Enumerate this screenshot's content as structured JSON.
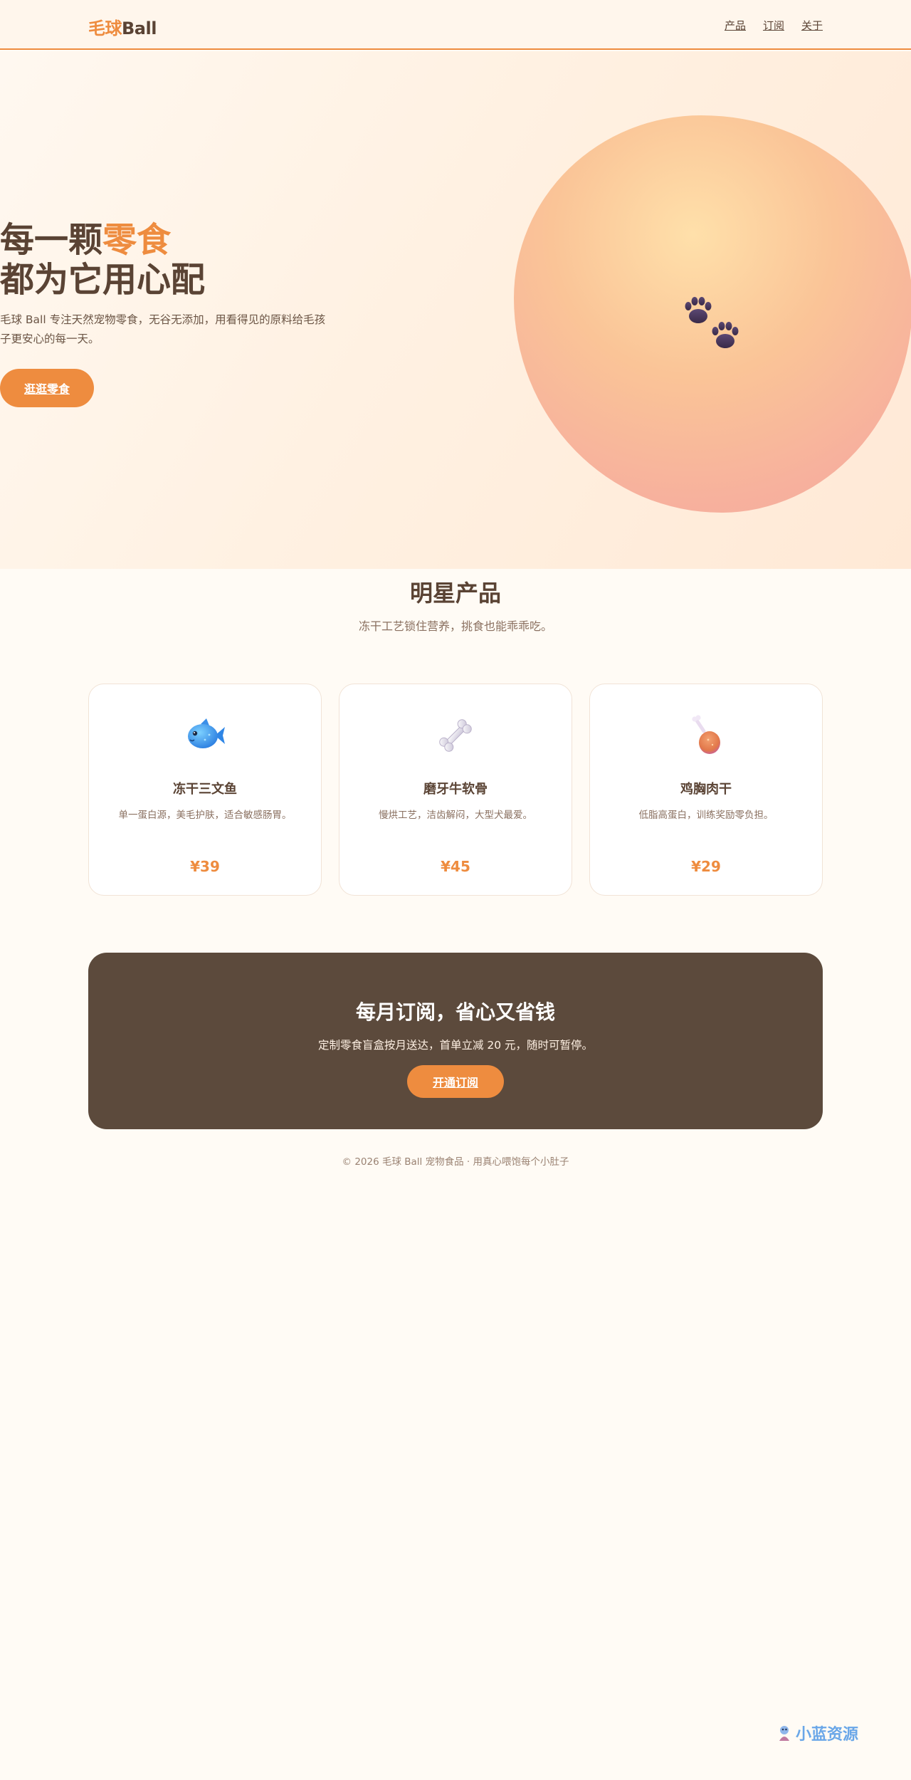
{
  "header": {
    "logo_accent": "毛球",
    "logo_rest": "Ball",
    "nav": [
      "产品",
      "订阅",
      "关于"
    ]
  },
  "hero": {
    "title_line1_prefix": "每一颗",
    "title_line1_highlight": "零食",
    "title_line2": "都为它用心配",
    "description": "毛球 Ball 专注天然宠物零食，无谷无添加，用看得见的原料给毛孩子更安心的每一天。",
    "cta_label": "逛逛零食",
    "icon": "paw-prints-icon"
  },
  "products": {
    "title": "明星产品",
    "subtitle": "冻干工艺锁住营养，挑食也能乖乖吃。",
    "items": [
      {
        "icon": "fish-icon",
        "name": "冻干三文鱼",
        "desc": "单一蛋白源，美毛护肤，适合敏感肠胃。",
        "price": "¥39"
      },
      {
        "icon": "bone-icon",
        "name": "磨牙牛软骨",
        "desc": "慢烘工艺，洁齿解闷，大型犬最爱。",
        "price": "¥45"
      },
      {
        "icon": "chicken-leg-icon",
        "name": "鸡胸肉干",
        "desc": "低脂高蛋白，训练奖励零负担。",
        "price": "¥29"
      }
    ]
  },
  "subscription": {
    "title": "每月订阅，省心又省钱",
    "description": "定制零食盲盒按月送达，首单立减 20 元，随时可暂停。",
    "cta_label": "开通订阅"
  },
  "footer": {
    "text": "© 2026 毛球 Ball 宠物食品 · 用真心喂饱每个小肚子"
  },
  "watermark": {
    "text": "小蓝资源"
  },
  "colors": {
    "accent": "#ee8c3f",
    "text_brown": "#5a4334",
    "banner_dark": "#5c4a3c",
    "background": "#fffbf5"
  }
}
